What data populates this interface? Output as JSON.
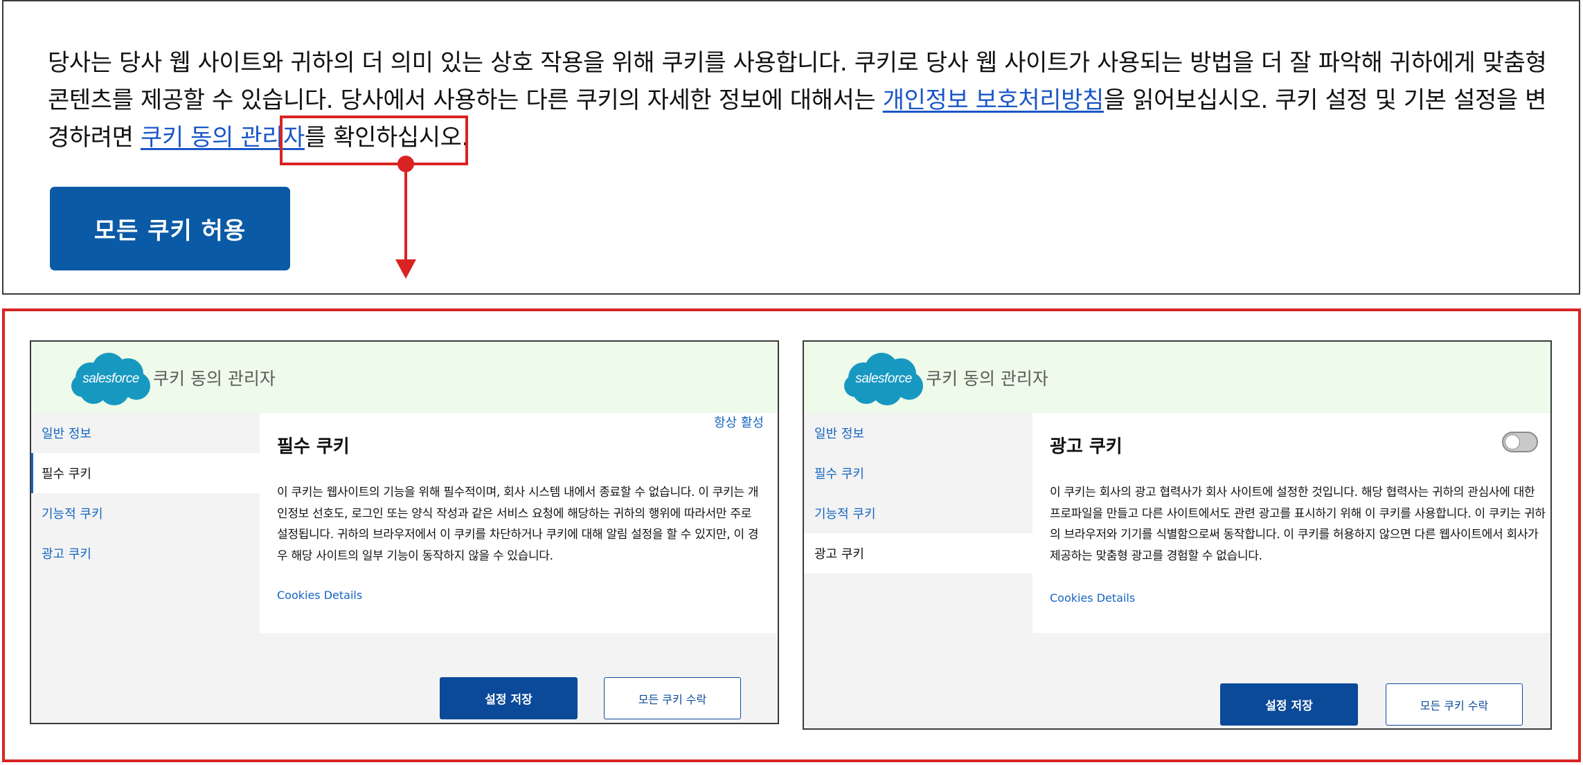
{
  "banner": {
    "text_part1": "당사는 당사 웹 사이트와 귀하의 더 의미 있는 상호 작용을 위해 쿠키를 사용합니다. 쿠키로 당사 웹 사이트가 사용되는 방법을 더 잘 파악해 귀하에게 맞춤형 콘텐츠를 제공할 수 있습니다. 당사에서 사용하는 다른 쿠키의 자세한 정보에 대해서는 ",
    "privacy_link": "개인정보 보호처리방침",
    "text_part2": "을 읽어보십시오. 쿠키 설정 및 기본 설정을 변경하려면 ",
    "consent_link": "쿠키 동의 관리자",
    "text_part3": "를 확인하십시오.",
    "allow_all_button": "모든 쿠키 허용"
  },
  "brand": {
    "logo_text": "salesforce",
    "logo_color": "#1798c1"
  },
  "panel_left": {
    "title": "쿠키 동의 관리자",
    "nav": [
      "일반 정보",
      "필수 쿠키",
      "기능적 쿠키",
      "광고 쿠키"
    ],
    "active_nav_index": 1,
    "status": "항상 활성",
    "heading": "필수 쿠키",
    "body": "이 쿠키는 웹사이트의 기능을 위해 필수적이며, 회사 시스템 내에서 종료할 수 없습니다. 이 쿠키는 개인정보 선호도, 로그인 또는 양식 작성과 같은 서비스 요청에 해당하는 귀하의 행위에 따라서만 주로 설정됩니다. 귀하의 브라우저에서 이 쿠키를 차단하거나 쿠키에 대해 알림 설정을 할 수 있지만, 이 경우 해당 사이트의 일부 기능이 동작하지 않을 수 있습니다.",
    "details_link": "Cookies Details",
    "save_button": "설정 저장",
    "accept_button": "모든 쿠키 수락"
  },
  "panel_right": {
    "title": "쿠키 동의 관리자",
    "nav": [
      "일반 정보",
      "필수 쿠키",
      "기능적 쿠키",
      "광고 쿠키"
    ],
    "active_nav_index": 3,
    "heading": "광고 쿠키",
    "toggle_on": false,
    "body": "이 쿠키는 회사의 광고 협력사가 회사 사이트에 설정한 것입니다. 해당 협력사는 귀하의 관심사에 대한 프로파일을 만들고 다른 사이트에서도 관련 광고를 표시하기 위해 이 쿠키를 사용합니다. 이 쿠키는 귀하의 브라우저와 기기를 식별함으로써 동작합니다. 이 쿠키를 허용하지 않으면 다른 웹사이트에서 회사가 제공하는 맞춤형 광고를 경험할 수 없습니다.",
    "details_link": "Cookies Details",
    "save_button": "설정 저장",
    "accept_button": "모든 쿠키 수락"
  },
  "colors": {
    "annotation_red": "#d92323",
    "primary_blue": "#0b5aa6",
    "link_blue": "#1565c0",
    "header_green": "#eefaea"
  }
}
